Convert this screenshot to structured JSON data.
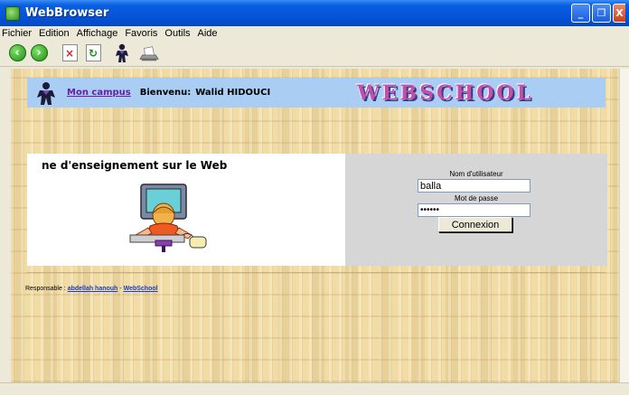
{
  "window": {
    "title": "WebBrowser",
    "min_label": "_",
    "max_label": "❐",
    "close_label": "X"
  },
  "menu": [
    {
      "label": "Fichier"
    },
    {
      "label": "Edition"
    },
    {
      "label": "Affichage"
    },
    {
      "label": "Favoris"
    },
    {
      "label": "Outils"
    },
    {
      "label": "Aide"
    }
  ],
  "toolbar": {
    "icons": [
      "back-arrow-icon",
      "forward-arrow-icon",
      "stop-icon",
      "refresh-icon",
      "person-icon",
      "print-icon"
    ]
  },
  "header": {
    "campus_link": "Mon campus",
    "welcome": "Bienvenu:",
    "user_name": "Walid HIDOUCI",
    "logo_text": "WEBSCHOOL"
  },
  "main": {
    "slogan": "ne d'enseignement sur le Web"
  },
  "login": {
    "username_label": "Nom d'utilisateur",
    "username_value": "balla",
    "password_label": "Mot de passe",
    "password_value": "••••••",
    "connect_button": "Connexion"
  },
  "footer": {
    "prefix": "Responsable :",
    "person_link": "abdellah hanouh",
    "separator": "-",
    "site_link": "WebSchool"
  },
  "colors": {
    "title_bar": "#0553d9",
    "header_band": "#a9cdf3",
    "login_panel": "#d6d6d6",
    "link_purple": "#6a1da6",
    "link_blue": "#1a3cc9",
    "background_texture": "#f1dca5"
  }
}
